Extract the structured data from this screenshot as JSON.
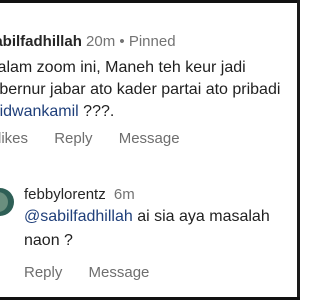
{
  "comment": {
    "username": "sabilfadhillah",
    "time": "20m",
    "separator": "•",
    "pinned_label": "Pinned",
    "text_line1": "Dalam zoom ini, Maneh teh keur jadi",
    "text_line2": "Gubernur jabar ato kader partai ato pribadi",
    "mention": "@ridwankamil",
    "text_after_mention": " ???.",
    "likes_label": "likes",
    "reply_label": "Reply",
    "message_label": "Message"
  },
  "reply": {
    "username": "febbylorentz",
    "time": "6m",
    "mention": "@sabilfadhillah",
    "text_line1_rest": " ai sia aya masalah",
    "text_line2": "naon ?",
    "reply_label": "Reply",
    "message_label": "Message"
  },
  "colors": {
    "mention": "#1f3f7a",
    "meta_gray": "#737373",
    "text": "#1f1f1f"
  }
}
